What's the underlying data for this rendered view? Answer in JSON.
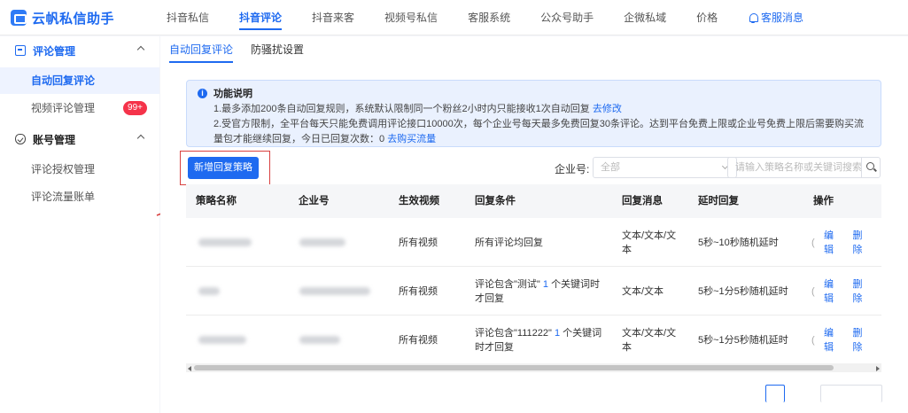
{
  "app": {
    "name": "云帆私信助手"
  },
  "nav": {
    "items": [
      "抖音私信",
      "抖音评论",
      "抖音来客",
      "视频号私信",
      "客服系统",
      "公众号助手",
      "企微私域",
      "价格"
    ],
    "active_index": 1,
    "service_label": "客服消息"
  },
  "sidebar": {
    "group1": {
      "label": "评论管理"
    },
    "items1": [
      {
        "label": "自动回复评论"
      },
      {
        "label": "视频评论管理",
        "badge": "99+"
      }
    ],
    "group2": {
      "label": "账号管理"
    },
    "items2": [
      {
        "label": "评论授权管理"
      },
      {
        "label": "评论流量账单"
      }
    ]
  },
  "tabs": [
    "自动回复评论",
    "防骚扰设置"
  ],
  "notice": {
    "title": "功能说明",
    "line1": "1.最多添加200条自动回复规则，系统默认限制同一个粉丝2小时内只能接收1次自动回复",
    "line1_link": "去修改",
    "line2": "2.受官方限制，全平台每天只能免费调用评论接口10000次，每个企业号每天最多免费回复30条评论。达到平台免费上限或企业号免费上限后需要购买流量包才能继续回复，今日已回复次数：0",
    "line2_link": "去购买流量"
  },
  "toolbar": {
    "add_label": "新增回复策略",
    "company_label": "企业号:",
    "select_value": "全部",
    "search_placeholder": "请输入策略名称或关键词搜索"
  },
  "table": {
    "headers": [
      "策略名称",
      "企业号",
      "生效视频",
      "回复条件",
      "回复消息",
      "延时回复",
      "操作"
    ],
    "rows": [
      {
        "video": "所有视频",
        "condition": "所有评论均回复",
        "message": "文本/文本/文本",
        "delay": "5秒~10秒随机延时",
        "edit": "编辑",
        "delete": "删除"
      },
      {
        "video": "所有视频",
        "condition_pre": "评论包含\"测试\"",
        "condition_num": "1",
        "condition_post": "个关键词时才回复",
        "message": "文本/文本",
        "delay": "5秒~1分5秒随机延时",
        "edit": "编辑",
        "delete": "删除"
      },
      {
        "video": "所有视频",
        "condition_pre": "评论包含\"111222\"",
        "condition_num": "1",
        "condition_post": "个关键词时才回复",
        "message": "文本/文本/文本",
        "delay": "5秒~1分5秒随机延时",
        "edit": "编辑",
        "delete": "删除"
      }
    ]
  },
  "colors": {
    "primary": "#1e6af0",
    "badge": "#f5334a",
    "highlight_box": "#d8403f"
  }
}
